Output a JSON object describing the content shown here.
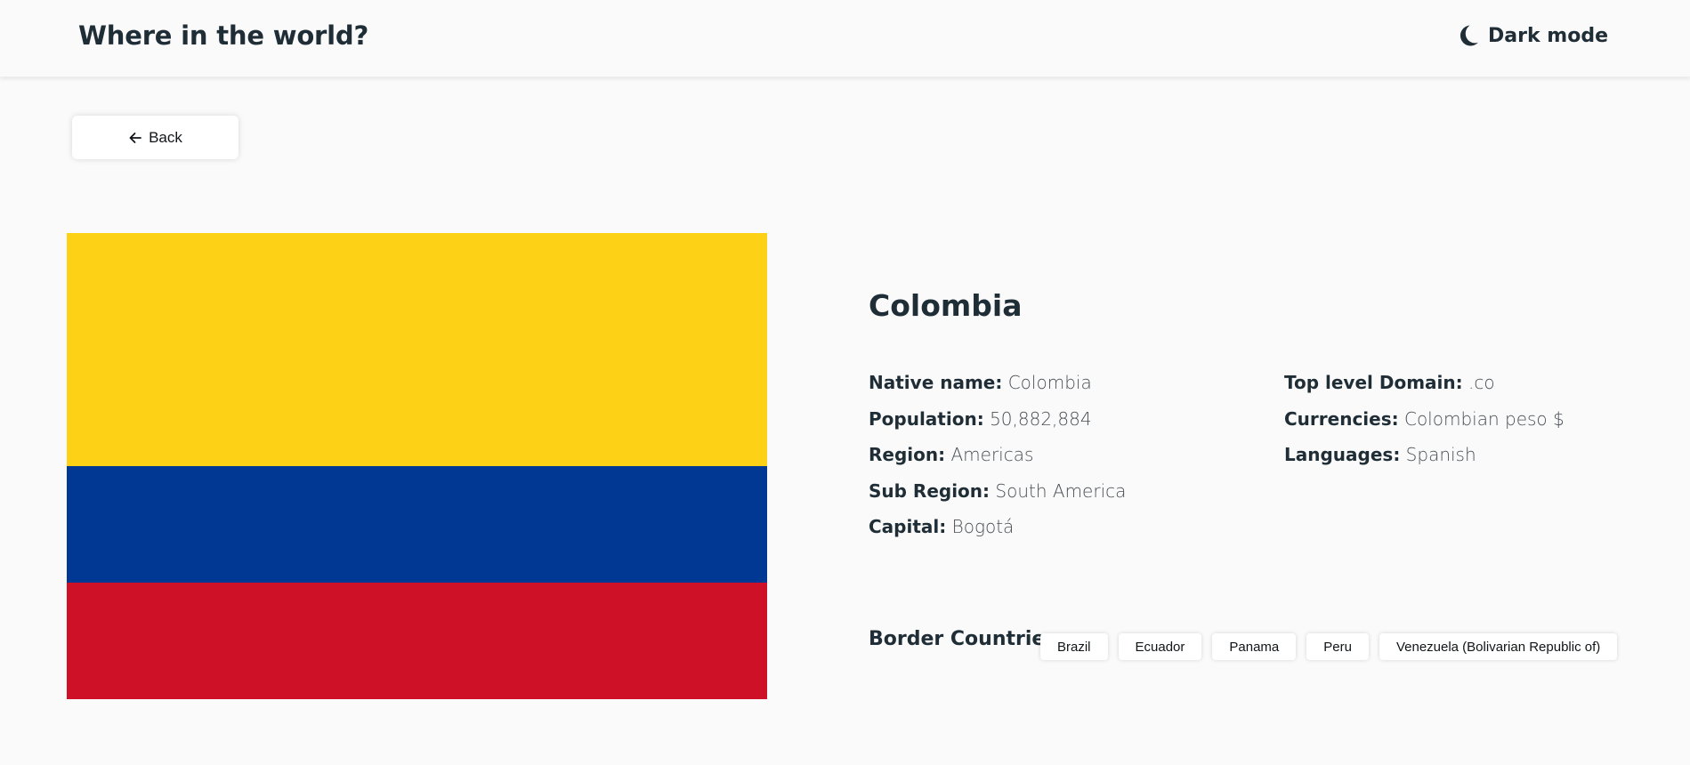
{
  "header": {
    "title": "Where in the world?",
    "theme_toggle_label": "Dark mode",
    "theme_icon": "moon-icon"
  },
  "back_button": {
    "label": "Back",
    "icon": "arrow-left-icon"
  },
  "flag": {
    "alt_country": "Colombia",
    "stripes": [
      {
        "color": "#FCD116",
        "share": 0.5
      },
      {
        "color": "#003893",
        "share": 0.25
      },
      {
        "color": "#CE1126",
        "share": 0.25
      }
    ]
  },
  "country": {
    "name": "Colombia",
    "left_details": [
      {
        "label": "Native name:",
        "value": "Colombia"
      },
      {
        "label": "Population:",
        "value": "50,882,884"
      },
      {
        "label": "Region:",
        "value": "Americas"
      },
      {
        "label": "Sub Region:",
        "value": "South America"
      },
      {
        "label": "Capital:",
        "value": "Bogotá"
      }
    ],
    "right_details": [
      {
        "label": "Top level Domain:",
        "value": ".co"
      },
      {
        "label": "Currencies:",
        "value": "Colombian peso $"
      },
      {
        "label": "Languages:",
        "value": "Spanish"
      }
    ]
  },
  "borders": {
    "label": "Border Countries:",
    "countries": [
      "Brazil",
      "Ecuador",
      "Panama",
      "Peru",
      "Venezuela (Bolivarian Republic of)"
    ]
  },
  "colors": {
    "background": "#fafafa",
    "text": "#1f2d36",
    "element": "#ffffff"
  }
}
